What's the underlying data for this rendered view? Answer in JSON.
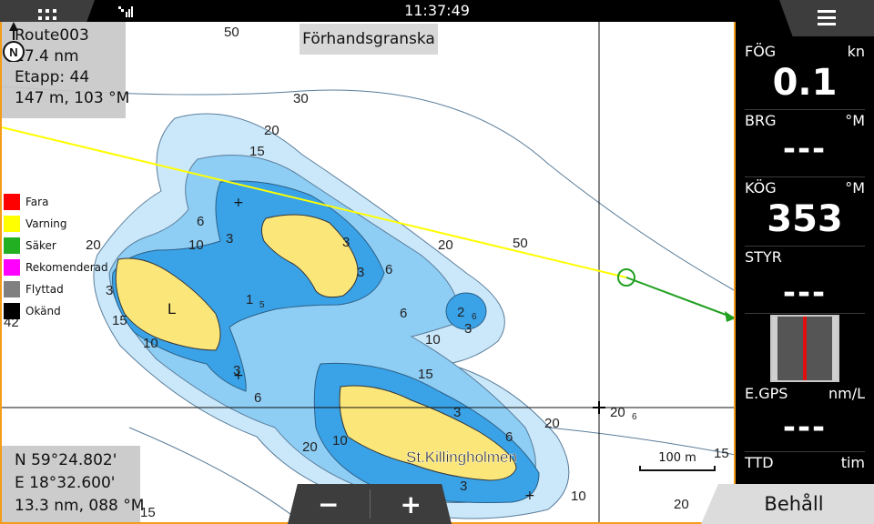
{
  "topbar": {
    "time": "11:37:49",
    "grid_icon": "grid-icon",
    "menu_icon": "hamburger-icon",
    "signal_icon": "gps-signal-icon"
  },
  "route_info": {
    "name": "Route003",
    "distance": "17.4 nm",
    "leg": "Etapp: 44",
    "leg_detail": "147 m, 103 °M"
  },
  "preview_button": "Förhandsgranska",
  "legend": [
    {
      "label": "Fara",
      "color": "#ff0000"
    },
    {
      "label": "Varning",
      "color": "#ffff00"
    },
    {
      "label": "Säker",
      "color": "#22b022"
    },
    {
      "label": "Rekomenderad",
      "color": "#ff00ff"
    },
    {
      "label": "Flyttad",
      "color": "#808080"
    },
    {
      "label": "Okänd",
      "color": "#000000"
    }
  ],
  "chart": {
    "island_label_1": "L",
    "island_label_2": "St.Killingholmen",
    "depths": [
      "50",
      "30",
      "20",
      "15",
      "6",
      "10",
      "3",
      "20",
      "3",
      "3",
      "6",
      "50",
      "20",
      "3",
      "1",
      "15",
      "10",
      "6",
      "2",
      "3",
      "10",
      "3",
      "6",
      "15",
      "3",
      "6",
      "20",
      "20",
      "10",
      "3",
      "10",
      "20",
      "15",
      "20",
      "15",
      "42"
    ],
    "depth_small": [
      "5",
      "6",
      "6"
    ],
    "scale": "100 m",
    "north": "N"
  },
  "position": {
    "lat": "N  59°24.802'",
    "lon": "E  18°32.600'",
    "range": "13.3 nm, 088 °M"
  },
  "zoom": {
    "out": "−",
    "in": "+"
  },
  "keep_button": "Behåll",
  "panel": {
    "sog_label": "FÖG",
    "sog_unit": "kn",
    "sog_value": "0.1",
    "brg_label": "BRG",
    "brg_unit": "°M",
    "brg_value": "---",
    "cog_label": "KÖG",
    "cog_unit": "°M",
    "cog_value": "353",
    "steer_label": "STYR",
    "steer_value": "---",
    "rudder_level": 0.5,
    "egps_label": "E.GPS",
    "egps_unit": "nm/L",
    "egps_value": "---",
    "ttd_label": "TTD",
    "ttd_unit": "tim"
  },
  "colors": {
    "accent": "#f59c1a",
    "land": "#fbe67a",
    "shallow": "#3aa3e8",
    "mid": "#8ecdf4",
    "deep": "#cbe8fb",
    "route_warning": "#ffff00",
    "route_safe": "#22a022"
  }
}
